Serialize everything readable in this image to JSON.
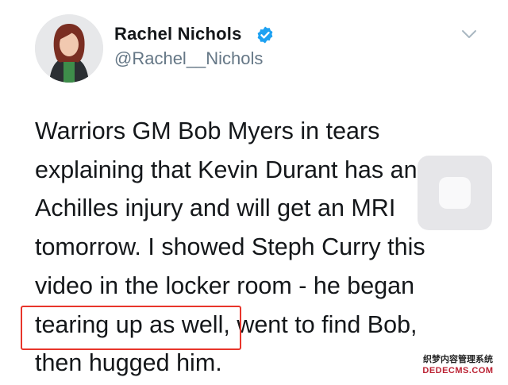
{
  "tweet": {
    "display_name": "Rachel Nichols",
    "handle": "@Rachel__Nichols",
    "verified": true,
    "lines": [
      "Warriors GM Bob Myers in tears",
      "explaining that Kevin Durant has an",
      "Achilles injury and will get an MRI",
      "tomorrow. I showed Steph Curry this",
      "video in the locker room - he began"
    ],
    "line6_highlighted": "tearing up as well,",
    "line6_rest": " went to find Bob,",
    "line7": "then hugged him.",
    "highlight_color": "#e8352b",
    "verified_color": "#1da1f2"
  },
  "watermark": {
    "line1": "织梦内容管理系统",
    "line2": "DEDECMS.COM"
  }
}
